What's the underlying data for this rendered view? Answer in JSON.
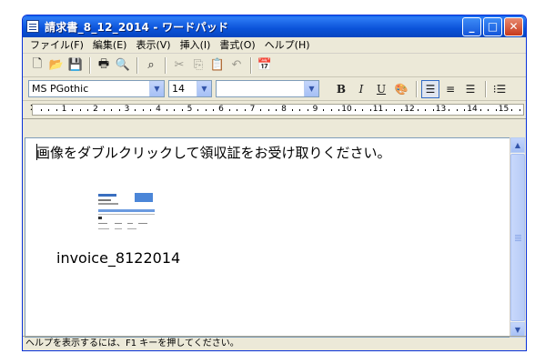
{
  "window": {
    "title": "請求書_8_12_2014 - ワードパッド"
  },
  "menu": [
    {
      "label": "ファイル(F)"
    },
    {
      "label": "編集(E)"
    },
    {
      "label": "表示(V)"
    },
    {
      "label": "挿入(I)"
    },
    {
      "label": "書式(O)"
    },
    {
      "label": "ヘルプ(H)"
    }
  ],
  "toolbar": {
    "icons": [
      "new-document-icon",
      "open-folder-icon",
      "save-icon",
      "print-icon",
      "print-preview-icon",
      "find-icon",
      "cut-icon",
      "copy-icon",
      "paste-icon",
      "undo-icon",
      "insert-datetime-icon"
    ]
  },
  "format": {
    "font": "MS PGothic",
    "size": "14",
    "script": "",
    "bold": "B",
    "italic": "I",
    "underline": "U"
  },
  "ruler": {
    "numbers": [
      "1",
      "2",
      "3",
      "4",
      "5",
      "6",
      "7",
      "8",
      "9",
      "10",
      "11",
      "12",
      "13",
      "14",
      "15"
    ]
  },
  "document": {
    "line1": "画像をダブルクリックして領収証をお受け取りください。",
    "image_caption": "invoice_8122014"
  },
  "status": {
    "text": "ヘルプを表示するには、F1 キーを押してください。"
  },
  "colors": {
    "titlebar": "#0b53d9",
    "face": "#ece9d8"
  }
}
